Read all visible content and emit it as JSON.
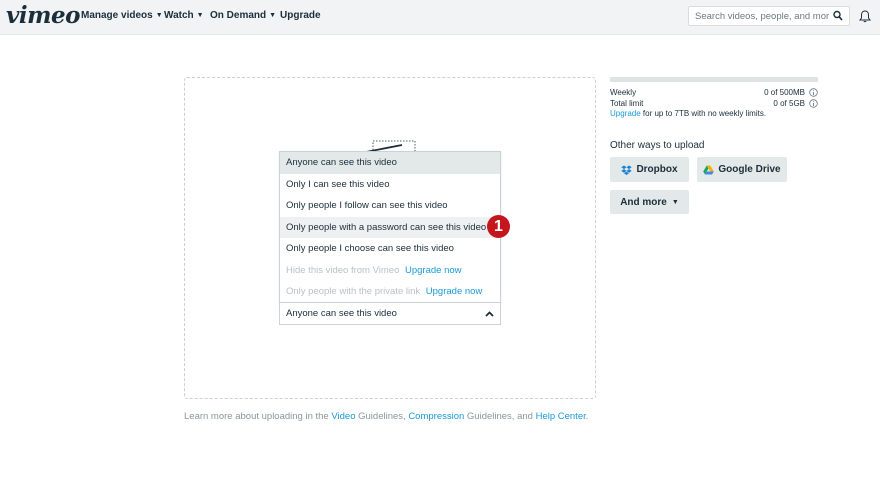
{
  "nav": {
    "logo": "vimeo",
    "items": [
      {
        "label": "Manage videos",
        "has_caret": true
      },
      {
        "label": "Watch",
        "has_caret": true
      },
      {
        "label": "On Demand",
        "has_caret": true
      },
      {
        "label": "Upgrade",
        "has_caret": false
      }
    ],
    "search_placeholder": "Search videos, people, and more",
    "icons": {
      "search": "search-icon",
      "notifications": "bell-icon"
    }
  },
  "privacy_dropdown": {
    "options": [
      {
        "label": "Anyone can see this video",
        "state": "selected"
      },
      {
        "label": "Only I can see this video",
        "state": "normal"
      },
      {
        "label": "Only people I follow can see this video",
        "state": "normal"
      },
      {
        "label": "Only people with a password can see this video",
        "state": "hover"
      },
      {
        "label": "Only people I choose can see this video",
        "state": "normal"
      },
      {
        "label": "Hide this video from Vimeo",
        "state": "disabled",
        "upgrade": "Upgrade now"
      },
      {
        "label": "Only people with the private link",
        "state": "disabled",
        "upgrade": "Upgrade now"
      }
    ],
    "selected_value": "Anyone can see this video",
    "step_badge": "1"
  },
  "quota": {
    "weekly_used_fraction": 0,
    "weekly_label": "Weekly",
    "weekly_value": "0 of 500MB",
    "total_label": "Total limit",
    "total_value": "0 of 5GB",
    "upgrade_link": "Upgrade",
    "upgrade_text": " for up to 7TB with no weekly limits."
  },
  "upload_options": {
    "heading": "Other ways to upload",
    "dropbox_label": "Dropbox",
    "google_drive_label": "Google Drive",
    "more_label": "And more"
  },
  "footer": {
    "prefix": "Learn more about uploading in the ",
    "video_link": "Video",
    "guidelines_1": " Guidelines, ",
    "compression_link": "Compression",
    "guidelines_2": " Guidelines, and ",
    "help_link": "Help Center",
    "suffix": "."
  },
  "colors": {
    "accent": "#1a9ad6",
    "badge": "#c5161d",
    "text": "#1a2e3b"
  }
}
